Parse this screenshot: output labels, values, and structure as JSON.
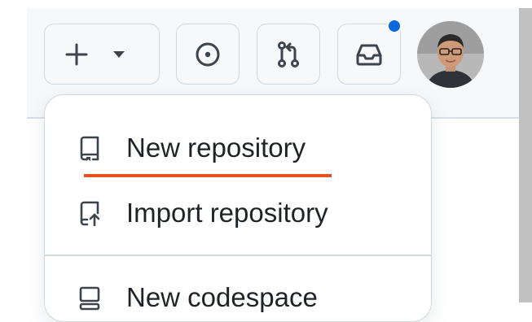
{
  "colors": {
    "header_bg": "#f6f8fa",
    "border": "#d1d9e0",
    "text": "#1f2328",
    "icon": "#59636e",
    "notification": "#0969da",
    "underline": "#e0531f",
    "scrollbar": "#c1c1c1"
  },
  "header": {
    "create_button": {
      "icon": "plus-icon",
      "caret": "triangle-down-icon"
    },
    "issues_button": {
      "icon": "issue-opened-icon"
    },
    "pulls_button": {
      "icon": "git-pull-request-icon"
    },
    "inbox_button": {
      "icon": "inbox-icon",
      "has_unread": true
    },
    "avatar": {
      "icon": "user-avatar"
    }
  },
  "menu": {
    "items": [
      {
        "label": "New repository",
        "icon": "repo-icon"
      },
      {
        "label": "Import repository",
        "icon": "repo-push-icon"
      },
      {
        "label": "New codespace",
        "icon": "codespaces-icon"
      }
    ]
  }
}
